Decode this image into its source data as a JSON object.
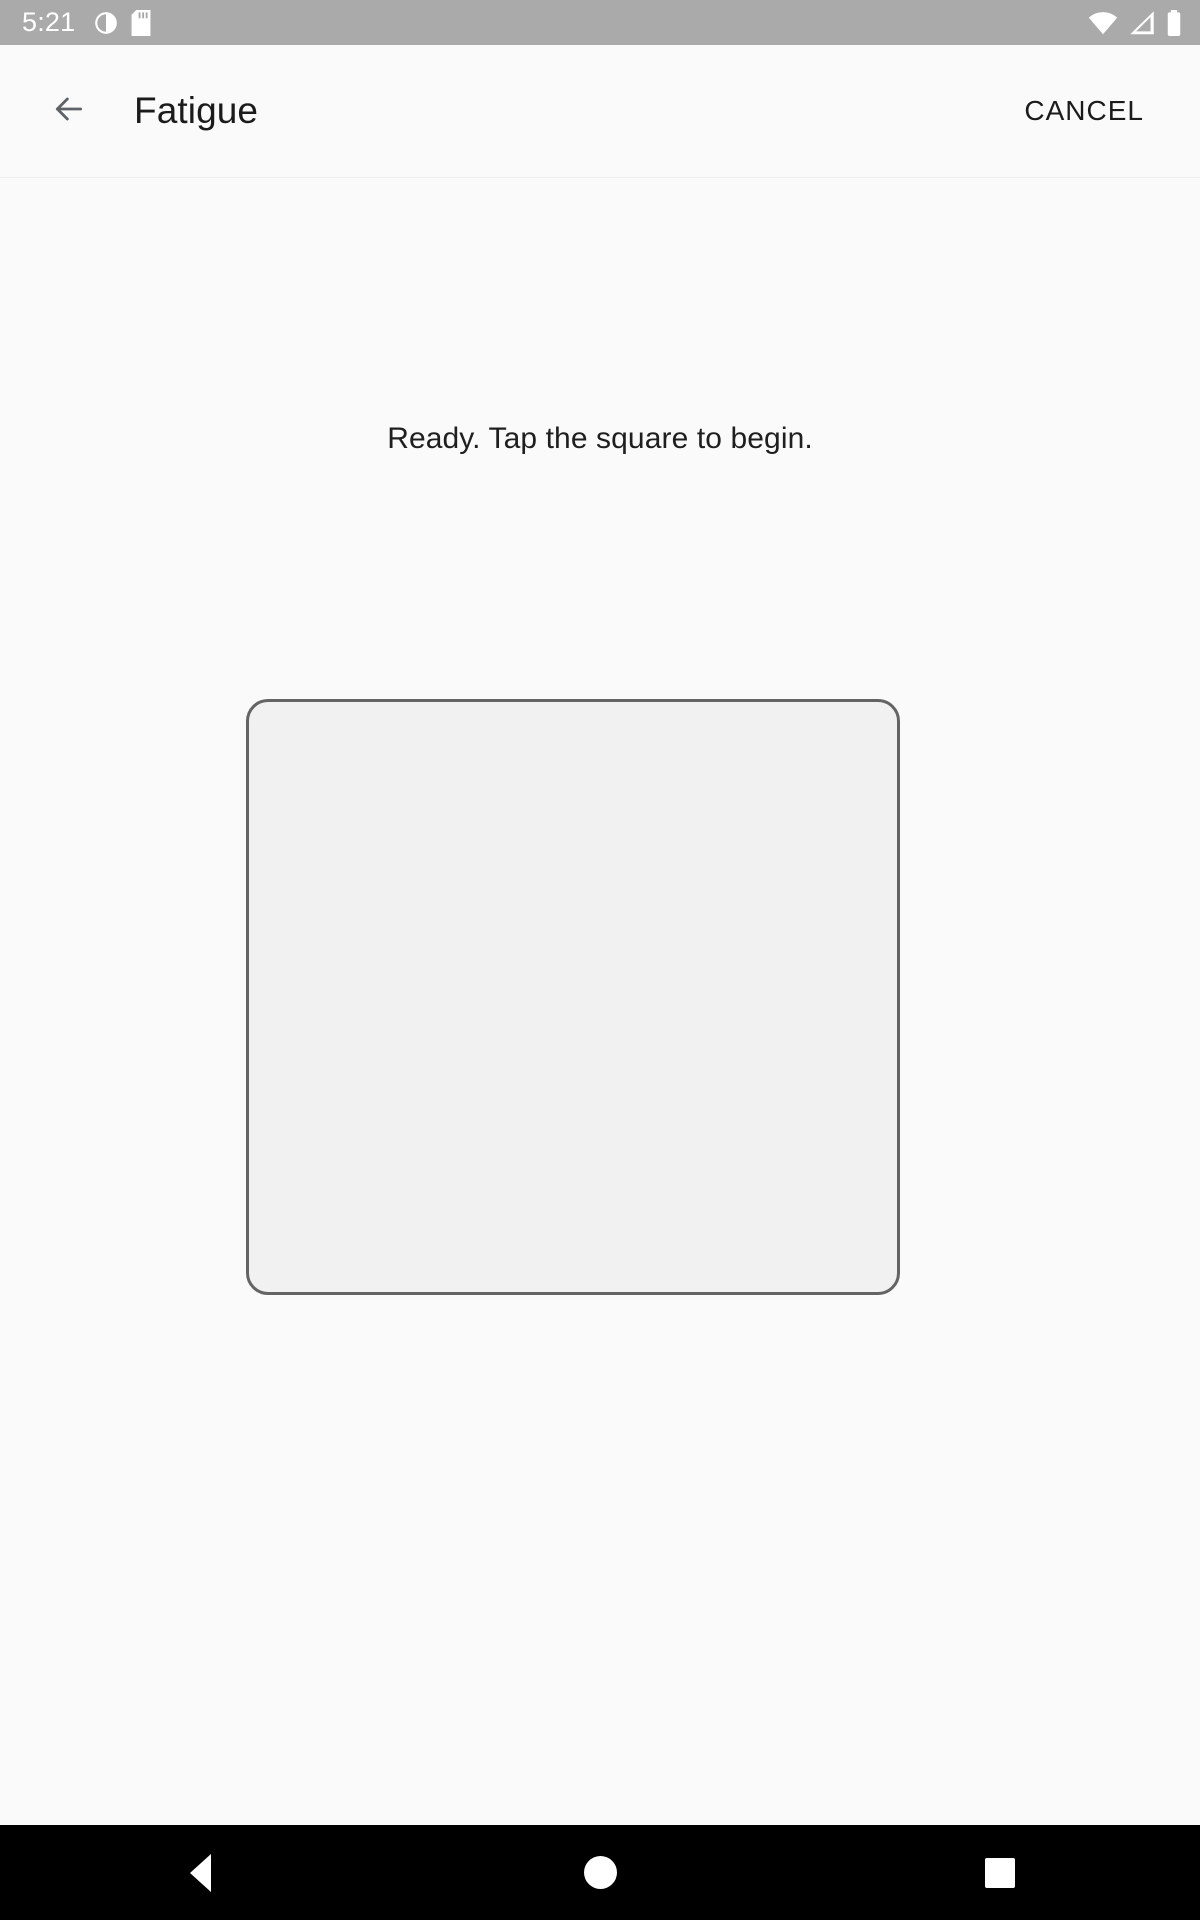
{
  "status_bar": {
    "time": "5:21",
    "left_icons": [
      "clock-alarm-icon",
      "sd-card-icon"
    ],
    "right_icons": [
      "wifi-icon",
      "cellular-signal-icon",
      "battery-icon"
    ],
    "background_color": "#aaaaaa",
    "icon_color": "#ffffff"
  },
  "app_bar": {
    "back_icon": "back-arrow-icon",
    "title": "Fatigue",
    "cancel_label": "CANCEL",
    "background_color": "#fafafa",
    "title_color": "#1b1b1b"
  },
  "content": {
    "status_message": "Ready. Tap the square to begin.",
    "square": {
      "label": "",
      "fill_color": "#f1f1f1",
      "border_color": "#646464"
    },
    "background_color": "#fafafa"
  },
  "nav_bar": {
    "back_icon": "nav-back-triangle-icon",
    "home_icon": "nav-home-circle-icon",
    "recents_icon": "nav-recents-square-icon",
    "background_color": "#000000"
  }
}
